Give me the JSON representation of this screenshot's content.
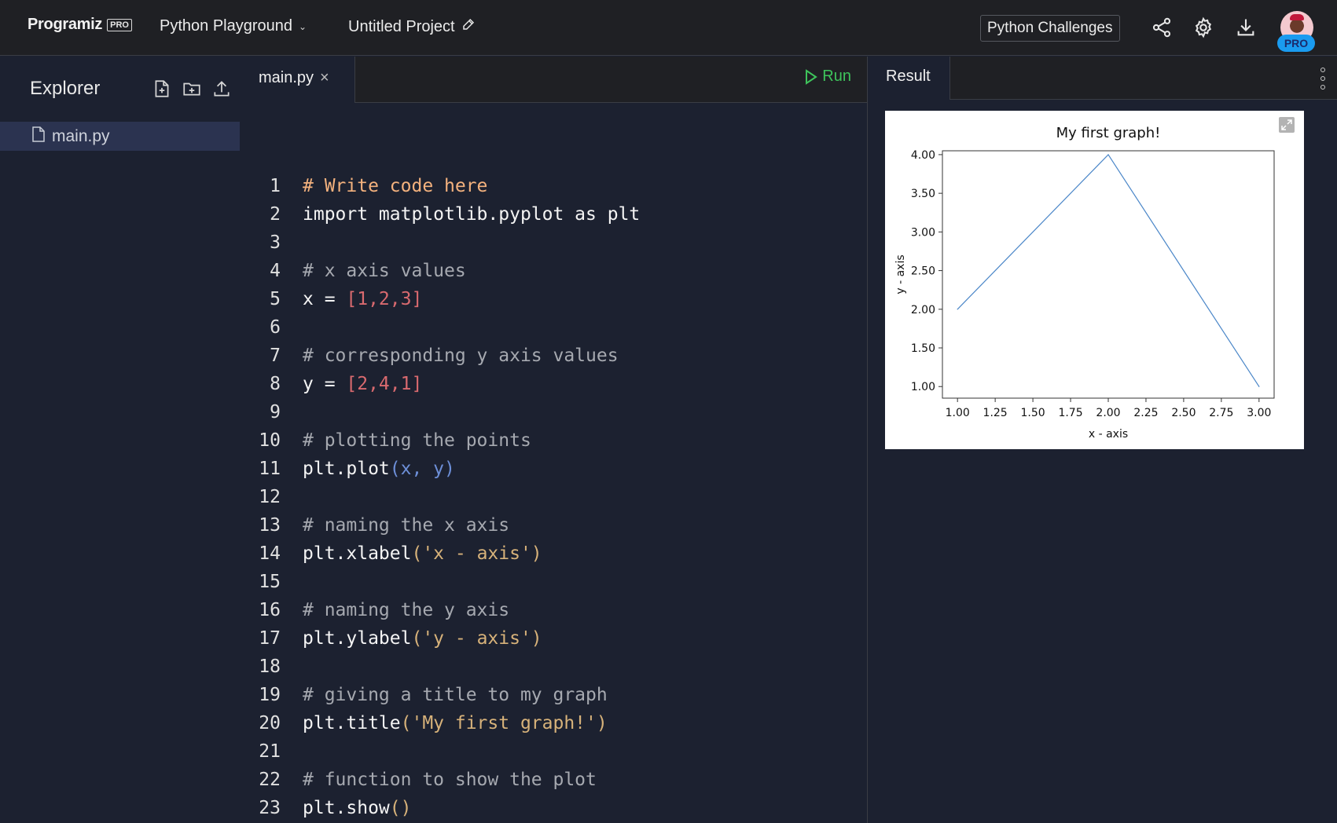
{
  "header": {
    "logo_text": "Programiz",
    "logo_badge": "PRO",
    "playground_label": "Python Playground",
    "project_name": "Untitled Project",
    "challenges_label": "Python Challenges",
    "icons": [
      "share-icon",
      "gear-icon",
      "download-icon"
    ],
    "avatar_badge": "PRO"
  },
  "sidebar": {
    "title": "Explorer",
    "actions": [
      "new-file-icon",
      "new-folder-icon",
      "upload-icon"
    ],
    "files": [
      {
        "name": "main.py",
        "selected": true
      }
    ]
  },
  "editor": {
    "tab_label": "main.py",
    "run_label": "Run",
    "lines": [
      {
        "n": "1",
        "tokens": [
          {
            "t": "# Write code here",
            "c": "hl"
          }
        ]
      },
      {
        "n": "2",
        "tokens": [
          {
            "t": "import matplotlib.pyplot as plt",
            "c": "plain"
          }
        ]
      },
      {
        "n": "3",
        "tokens": []
      },
      {
        "n": "4",
        "tokens": [
          {
            "t": "# x axis values",
            "c": "comment"
          }
        ]
      },
      {
        "n": "5",
        "tokens": [
          {
            "t": "x = ",
            "c": "plain"
          },
          {
            "t": "[1,2,3]",
            "c": "num"
          }
        ]
      },
      {
        "n": "6",
        "tokens": []
      },
      {
        "n": "7",
        "tokens": [
          {
            "t": "# corresponding y axis values",
            "c": "comment"
          }
        ]
      },
      {
        "n": "8",
        "tokens": [
          {
            "t": "y = ",
            "c": "plain"
          },
          {
            "t": "[2,4,1]",
            "c": "num"
          }
        ]
      },
      {
        "n": "9",
        "tokens": []
      },
      {
        "n": "10",
        "tokens": [
          {
            "t": "# plotting the points",
            "c": "comment"
          }
        ]
      },
      {
        "n": "11",
        "tokens": [
          {
            "t": "plt.plot",
            "c": "plain"
          },
          {
            "t": "(x, y)",
            "c": "arg"
          }
        ]
      },
      {
        "n": "12",
        "tokens": []
      },
      {
        "n": "13",
        "tokens": [
          {
            "t": "# naming the x axis",
            "c": "comment"
          }
        ]
      },
      {
        "n": "14",
        "tokens": [
          {
            "t": "plt.xlabel",
            "c": "plain"
          },
          {
            "t": "('x - axis')",
            "c": "str"
          }
        ]
      },
      {
        "n": "15",
        "tokens": []
      },
      {
        "n": "16",
        "tokens": [
          {
            "t": "# naming the y axis",
            "c": "comment"
          }
        ]
      },
      {
        "n": "17",
        "tokens": [
          {
            "t": "plt.ylabel",
            "c": "plain"
          },
          {
            "t": "('y - axis')",
            "c": "str"
          }
        ]
      },
      {
        "n": "18",
        "tokens": []
      },
      {
        "n": "19",
        "tokens": [
          {
            "t": "# giving a title to my graph",
            "c": "comment"
          }
        ]
      },
      {
        "n": "20",
        "tokens": [
          {
            "t": "plt.title",
            "c": "plain"
          },
          {
            "t": "('My first graph!')",
            "c": "str"
          }
        ]
      },
      {
        "n": "21",
        "tokens": []
      },
      {
        "n": "22",
        "tokens": [
          {
            "t": "# function to show the plot",
            "c": "comment"
          }
        ]
      },
      {
        "n": "23",
        "tokens": [
          {
            "t": "plt.show",
            "c": "plain"
          },
          {
            "t": "()",
            "c": "paren"
          }
        ]
      }
    ]
  },
  "result": {
    "tab_label": "Result",
    "expand_icon": "expand-icon",
    "menu_icon": "kebab-menu-icon"
  },
  "colors": {
    "run_green": "#3ec35b",
    "pro_blue": "#1a9bf0",
    "line_blue": "#4a86c8"
  },
  "chart_data": {
    "type": "line",
    "title": "My first graph!",
    "xlabel": "x - axis",
    "ylabel": "y - axis",
    "x": [
      1,
      2,
      3
    ],
    "series": [
      {
        "name": "y",
        "values": [
          2,
          4,
          1
        ],
        "color": "#4a86c8"
      }
    ],
    "xlim": [
      0.9,
      3.1
    ],
    "ylim": [
      0.85,
      4.05
    ],
    "xticks": [
      "1.00",
      "1.25",
      "1.50",
      "1.75",
      "2.00",
      "2.25",
      "2.50",
      "2.75",
      "3.00"
    ],
    "yticks": [
      "1.00",
      "1.50",
      "2.00",
      "2.50",
      "3.00",
      "3.50",
      "4.00"
    ],
    "grid": false,
    "legend": "none"
  }
}
